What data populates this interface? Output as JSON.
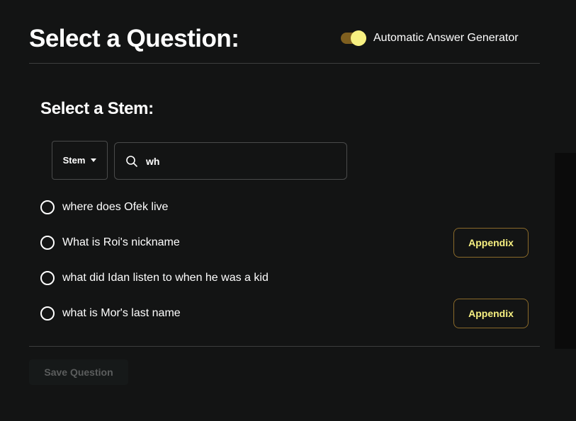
{
  "header": {
    "title": "Select a Question:",
    "toggle": {
      "label": "Automatic Answer Generator",
      "on": true
    }
  },
  "stem_section": {
    "title": "Select a Stem:",
    "filter_select": {
      "selected": "Stem"
    },
    "search": {
      "value": "wh"
    }
  },
  "questions": [
    {
      "text": "where does Ofek live",
      "selected": false,
      "has_appendix": false
    },
    {
      "text": "What is Roi's nickname",
      "selected": false,
      "has_appendix": true,
      "appendix_label": "Appendix"
    },
    {
      "text": "what did Idan listen to when he was a kid",
      "selected": false,
      "has_appendix": false
    },
    {
      "text": "what is Mor's last name",
      "selected": false,
      "has_appendix": true,
      "appendix_label": "Appendix"
    }
  ],
  "footer": {
    "save_label": "Save Question",
    "save_enabled": false
  },
  "colors": {
    "background": "#131414",
    "accent": "#f7f081",
    "toggle_track": "#7f5f1f",
    "appendix_border": "#8a6a2a",
    "divider": "#3d3e3e"
  }
}
